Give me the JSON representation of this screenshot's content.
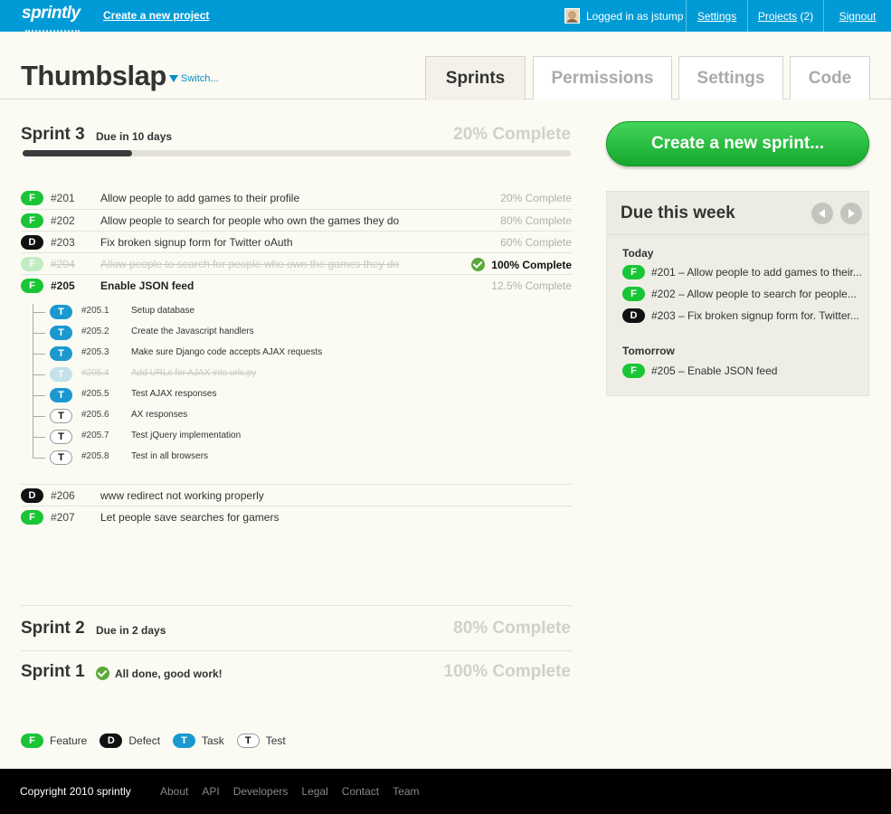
{
  "topbar": {
    "logo": "sprintly",
    "create_project": "Create a new project",
    "user": "Logged in as jstump",
    "links": [
      {
        "label": "Settings"
      },
      {
        "label": "Projects",
        "suffix": " (2)"
      },
      {
        "label": "Signout"
      }
    ]
  },
  "header": {
    "project": "Thumbslap",
    "switch": "Switch...",
    "tabs": [
      "Sprints",
      "Permissions",
      "Settings",
      "Code"
    ],
    "active_tab": "Sprints"
  },
  "sprint3": {
    "title": "Sprint 3",
    "due": "Due in 10 days",
    "complete": "20% Complete",
    "progress": 0.2,
    "items": [
      {
        "type": "F",
        "num": "#201",
        "title": "Allow people to add games to their profile",
        "pct": "20% Complete"
      },
      {
        "type": "F",
        "num": "#202",
        "title": "Allow people to search for people who own the games they do",
        "pct": "80% Complete"
      },
      {
        "type": "D",
        "num": "#203",
        "title": "Fix broken signup form for Twitter oAuth",
        "pct": "60% Complete"
      },
      {
        "type": "F",
        "num": "#204",
        "title": "Allow people to search for people who own the games they do",
        "pct": "100% Complete"
      },
      {
        "type": "F",
        "num": "#205",
        "title": "Enable JSON feed",
        "pct": "12.5% Complete"
      }
    ],
    "subtasks": [
      {
        "type": "T",
        "num": "#205.1",
        "title": "Setup database"
      },
      {
        "type": "T",
        "num": "#205.2",
        "title": "Create the Javascript handlers"
      },
      {
        "type": "T",
        "num": "#205.3",
        "title": "Make sure Django code accepts AJAX requests"
      },
      {
        "type": "T",
        "num": "#205.4",
        "title": "Add URLs for AJAX into urls.py"
      },
      {
        "type": "T",
        "num": "#205.5",
        "title": "Test AJAX responses"
      },
      {
        "type": "T",
        "num": "#205.6",
        "title": "AX responses"
      },
      {
        "type": "T",
        "num": "#205.7",
        "title": "Test jQuery implementation"
      },
      {
        "type": "T",
        "num": "#205.8",
        "title": "Test in all browsers"
      }
    ],
    "more_items": [
      {
        "type": "D",
        "num": "#206",
        "title": "www redirect not working properly"
      },
      {
        "type": "F",
        "num": "#207",
        "title": "Let people save searches for gamers"
      }
    ]
  },
  "sprint2": {
    "title": "Sprint 2",
    "due": "Due in 2 days",
    "complete": "80% Complete"
  },
  "sprint1": {
    "title": "Sprint 1",
    "note": "All done, good work!",
    "complete": "100% Complete"
  },
  "legend": [
    {
      "badge": "F",
      "label": "Feature"
    },
    {
      "badge": "D",
      "label": "Defect"
    },
    {
      "badge": "T",
      "label": "Task"
    },
    {
      "badge": "T",
      "label": "Test"
    }
  ],
  "sidebar": {
    "create_sprint": "Create a new sprint...",
    "due_title": "Due this week",
    "today_label": "Today",
    "today": [
      {
        "type": "F",
        "text": "#201 – Allow people to add games to their..."
      },
      {
        "type": "F",
        "text": "#202 – Allow people to search for people..."
      },
      {
        "type": "D",
        "text": "#203 – Fix broken signup form for. Twitter..."
      }
    ],
    "tomorrow_label": "Tomorrow",
    "tomorrow": [
      {
        "type": "F",
        "text": "#205 – Enable JSON feed"
      }
    ]
  },
  "footer": {
    "copyright": "Copyright 2010 sprintly",
    "links": [
      "About",
      "API",
      "Developers",
      "Legal",
      "Contact",
      "Team"
    ]
  },
  "colors": {
    "topbar": "#009bd6",
    "feature": "#19c535",
    "defect": "#111111",
    "task": "#1b98d0",
    "button_green": "#27c03f"
  }
}
